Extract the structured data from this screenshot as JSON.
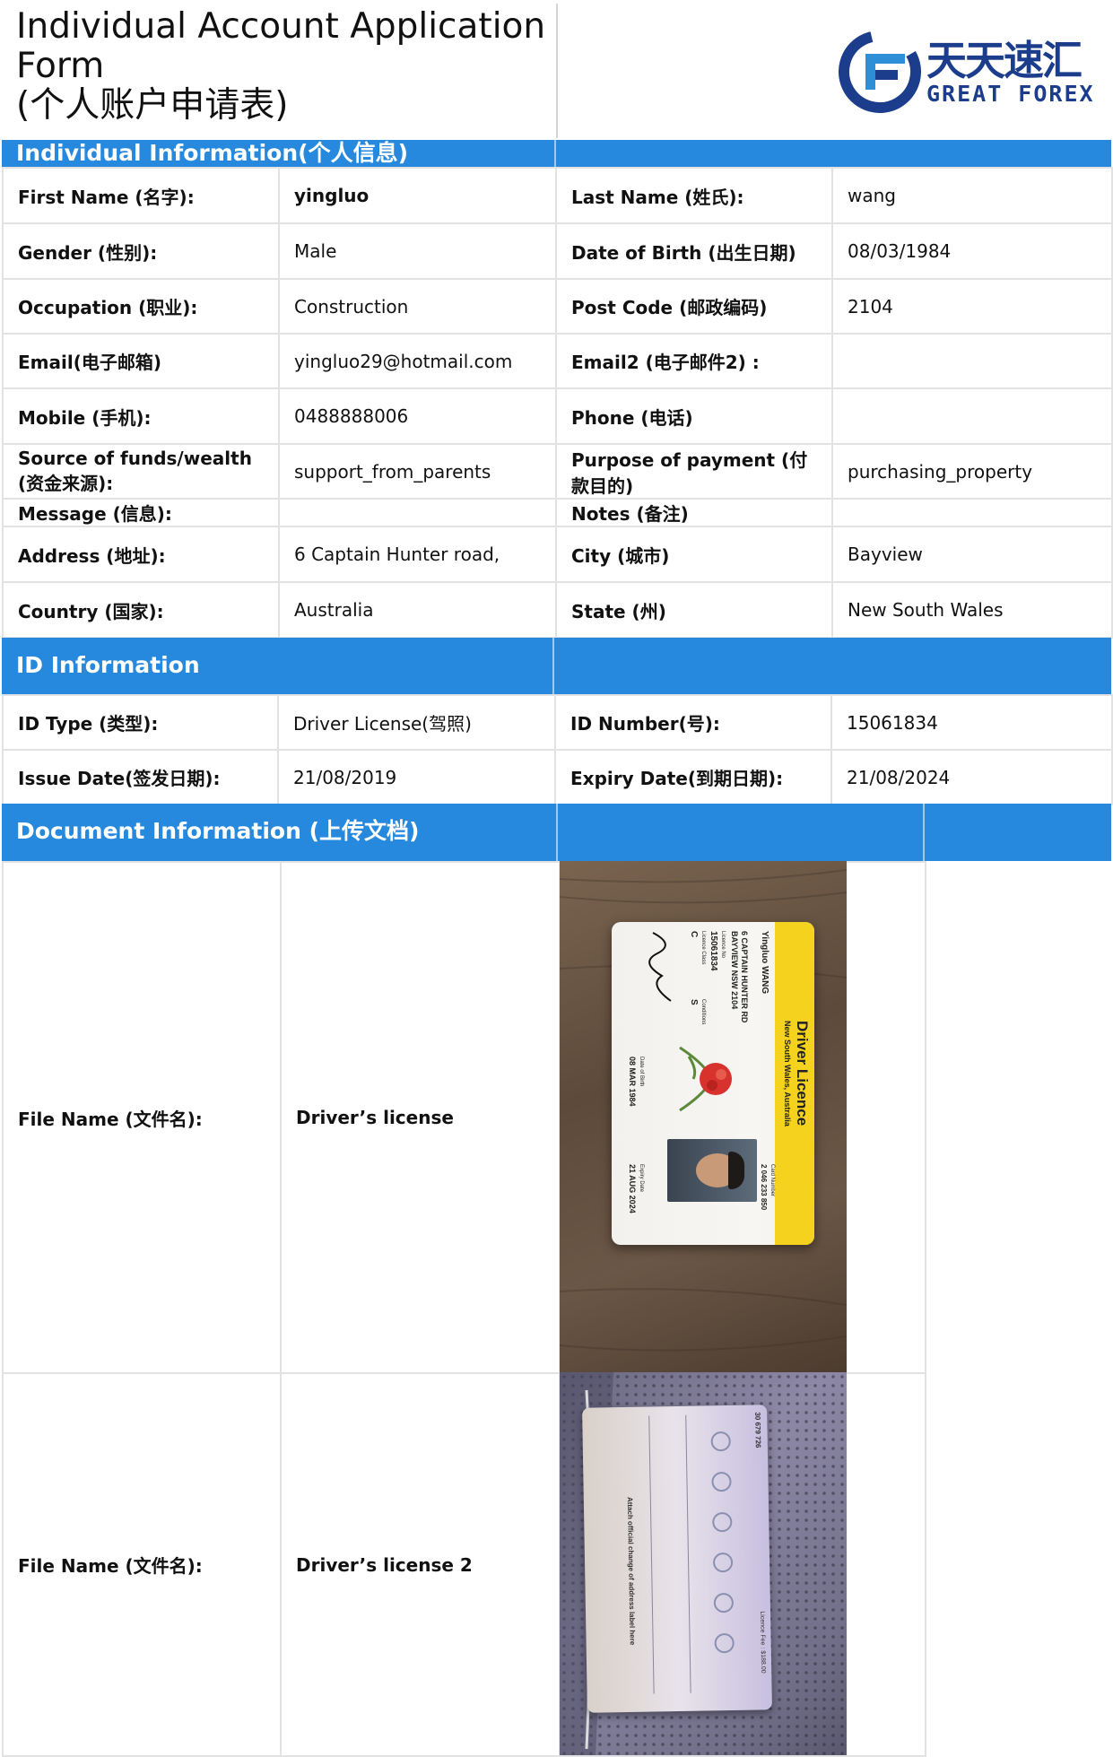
{
  "header": {
    "title_line1": "Individual Account Application",
    "title_line2": "Form",
    "title_line3": "(个人账户申请表)",
    "logo_cn": "天天速汇",
    "logo_en": "GREAT FOREX",
    "logo_color": "#1b3d8c"
  },
  "colors": {
    "section_bar": "#2689dd",
    "border": "#e2e2e2"
  },
  "individual": {
    "section_title": "Individual Information(个人信息)",
    "rows": [
      [
        "First Name (名字):",
        "yingluo",
        "Last Name (姓氏):",
        "wang"
      ],
      [
        "Gender (性别):",
        "Male",
        "Date of Birth (出生日期)",
        "08/03/1984"
      ],
      [
        "Occupation (职业):",
        "Construction",
        "Post Code (邮政编码)",
        "2104"
      ],
      [
        "Email(电子邮箱)",
        "yingluo29@hotmail.com",
        "Email2 (电子邮件2) :",
        ""
      ],
      [
        "Mobile (手机):",
        "0488888006",
        "Phone (电话)",
        ""
      ],
      [
        "Source of funds/wealth (资金来源):",
        "support_from_parents",
        "Purpose of payment (付款目的)",
        "purchasing_property"
      ],
      [
        "Message (信息):",
        "",
        "Notes (备注)",
        ""
      ],
      [
        "Address (地址):",
        "6 Captain Hunter road,",
        "City (城市)",
        "Bayview"
      ],
      [
        "Country (国家):",
        "Australia",
        "State (州)",
        "New South Wales"
      ]
    ]
  },
  "id_info": {
    "section_title": "ID Information",
    "rows": [
      [
        "ID Type (类型):",
        "Driver License(驾照)",
        "ID Number(号):",
        "15061834"
      ],
      [
        "Issue Date(签发日期):",
        "21/08/2019",
        "Expiry Date(到期日期):",
        "21/08/2024"
      ]
    ]
  },
  "documents": {
    "section_title": "Document Information (上传文档)",
    "files": [
      {
        "key": "File Name (文件名):",
        "value": "Driver’s license",
        "card": {
          "title": "Driver Licence",
          "subtitle": "New South Wales, Australia",
          "name": "Yingluo WANG",
          "address1": "6 CAPTAIN HUNTER RD",
          "address2": "BAYVIEW NSW 2104",
          "licence_no_label": "Licence No",
          "licence_no": "15061834",
          "class_label": "Licence Class",
          "class": "C",
          "conditions_label": "Conditions",
          "conditions": "S",
          "dob_label": "Date of Birth",
          "dob": "08 MAR 1984",
          "expiry_label": "Expiry Date",
          "expiry": "21 AUG 2024",
          "card_no_label": "Card Number",
          "card_no": "2 046 233 850"
        }
      },
      {
        "key": "File Name (文件名):",
        "value": "Driver’s license 2",
        "card": {
          "number": "30 679 726",
          "fee": "Licence Fee : $188.00",
          "address_note": "Attach official change of address label here"
        }
      }
    ]
  }
}
